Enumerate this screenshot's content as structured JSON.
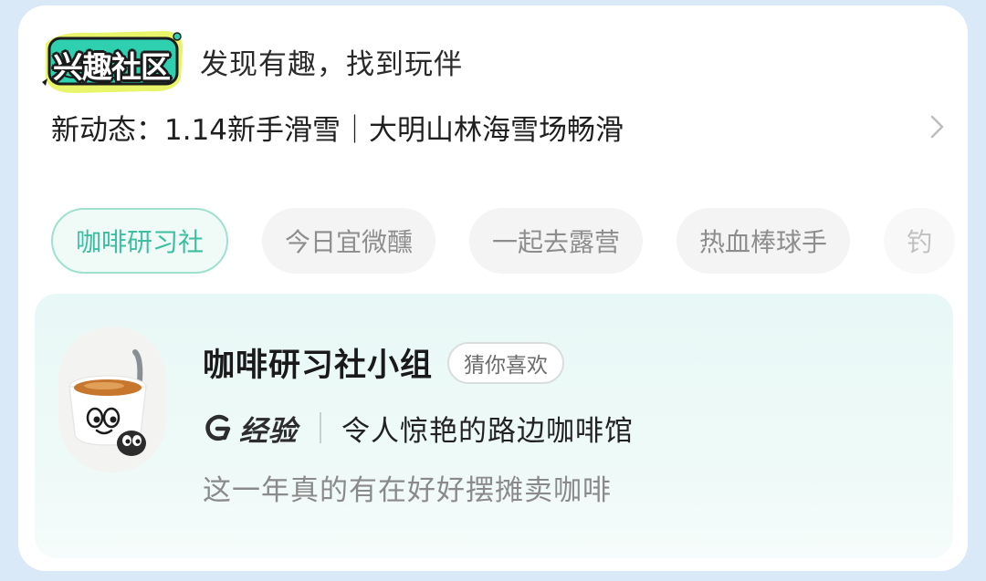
{
  "header": {
    "logo_text": "兴趣社区",
    "slogan": "发现有趣，找到玩伴"
  },
  "news": {
    "text": "新动态：1.14新手滑雪｜大明山林海雪场畅滑"
  },
  "tags": [
    {
      "label": "咖啡研习社",
      "active": true
    },
    {
      "label": "今日宜微醺",
      "active": false
    },
    {
      "label": "一起去露营",
      "active": false
    },
    {
      "label": "热血棒球手",
      "active": false
    },
    {
      "label": "钓",
      "active": false
    }
  ],
  "group": {
    "title": "咖啡研习社小组",
    "badge": "猜你喜欢",
    "experience_label": "经验",
    "experience_text": "令人惊艳的路边咖啡馆",
    "description": "这一年真的有在好好摆摊卖咖啡"
  },
  "colors": {
    "accent_green": "#3bbfa0",
    "logo_yellow": "#e8f56a",
    "logo_teal": "#2fd0b0",
    "panel_bg": "#e8f8f6"
  }
}
